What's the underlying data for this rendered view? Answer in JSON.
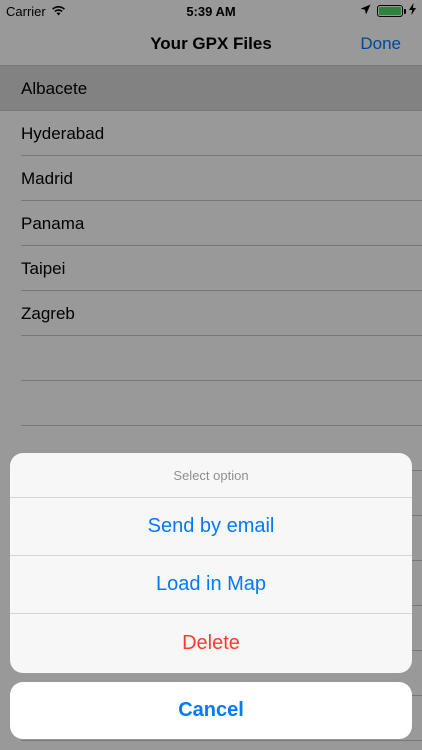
{
  "status_bar": {
    "carrier": "Carrier",
    "time": "5:39 AM",
    "battery_level": 1.0,
    "battery_color": "#4cd964"
  },
  "nav": {
    "title": "Your GPX Files",
    "done_label": "Done"
  },
  "files": [
    "Albacete",
    "Hyderabad",
    "Madrid",
    "Panama",
    "Taipei",
    "Zagreb"
  ],
  "selected_file": "Albacete",
  "action_sheet": {
    "title": "Select option",
    "options": [
      {
        "label": "Send by email",
        "style": "default"
      },
      {
        "label": "Load in Map",
        "style": "default"
      },
      {
        "label": "Delete",
        "style": "destructive"
      }
    ],
    "cancel_label": "Cancel"
  },
  "colors": {
    "accent": "#007aff",
    "destructive": "#ff3b30"
  }
}
